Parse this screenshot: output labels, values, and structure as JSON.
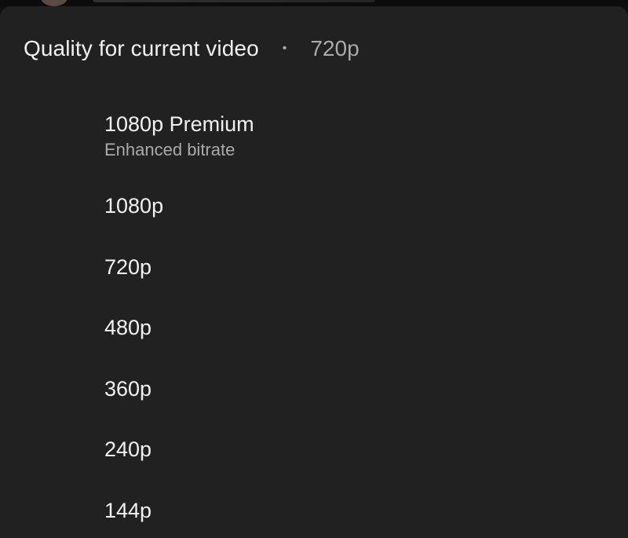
{
  "header": {
    "title": "Quality for current video",
    "separator": "•",
    "current_quality": "720p"
  },
  "options": [
    {
      "label": "1080p Premium",
      "sublabel": "Enhanced bitrate"
    },
    {
      "label": "1080p"
    },
    {
      "label": "720p"
    },
    {
      "label": "480p"
    },
    {
      "label": "360p"
    },
    {
      "label": "240p"
    },
    {
      "label": "144p"
    }
  ],
  "colors": {
    "sheet_background": "#212121",
    "primary_text": "#f1f1f1",
    "secondary_text": "#aaaaaa"
  }
}
